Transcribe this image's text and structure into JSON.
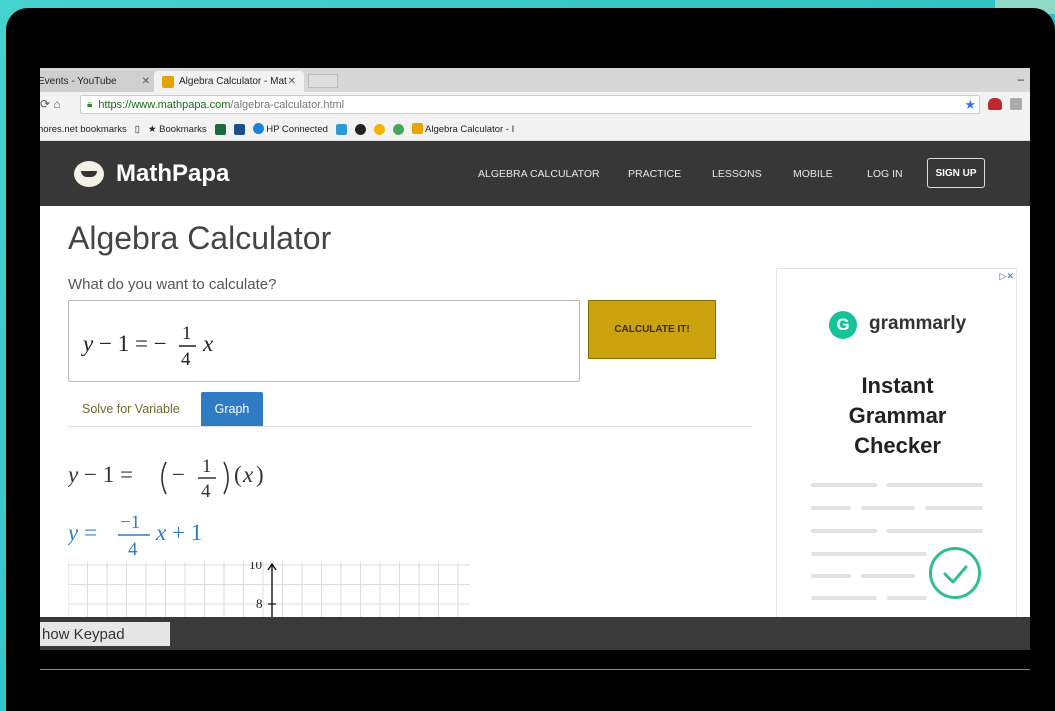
{
  "browser": {
    "tabs": [
      {
        "label": "Events - YouTube"
      },
      {
        "label": "Algebra Calculator - Mat"
      }
    ],
    "url_main": "https://www.mathpapa.com",
    "url_rest": "/algebra-calculator.html",
    "bookmarks": [
      "hores.net bookmarks",
      "Bookmarks",
      "HP Connected",
      "Algebra Calculator - I"
    ]
  },
  "site": {
    "brand": "MathPapa",
    "nav": [
      "ALGEBRA CALCULATOR",
      "PRACTICE",
      "LESSONS",
      "MOBILE",
      "LOG IN"
    ],
    "signup": "SIGN UP"
  },
  "main": {
    "title": "Algebra Calculator",
    "question": "What do you want to calculate?",
    "input_value": "y − 1 = −(1/4)x",
    "calculate_label": "CALCULATE IT!",
    "tabs": [
      "Solve for Variable",
      "Graph"
    ],
    "active_tab": "Graph",
    "step1": "y − 1 = (−1/4)(x)",
    "step2": "y = (−1/4)x + 1",
    "graph_ticks": [
      "10",
      "8"
    ]
  },
  "ad": {
    "choice": "▷✕",
    "brand": "grammarly",
    "brand_letter": "G",
    "headline": [
      "Instant",
      "Grammar",
      "Checker"
    ]
  },
  "keypad": {
    "label": "how Keypad"
  },
  "colors": {
    "accent": "#2f7bc4",
    "calc_button": "#caa30f",
    "header": "#373737"
  }
}
